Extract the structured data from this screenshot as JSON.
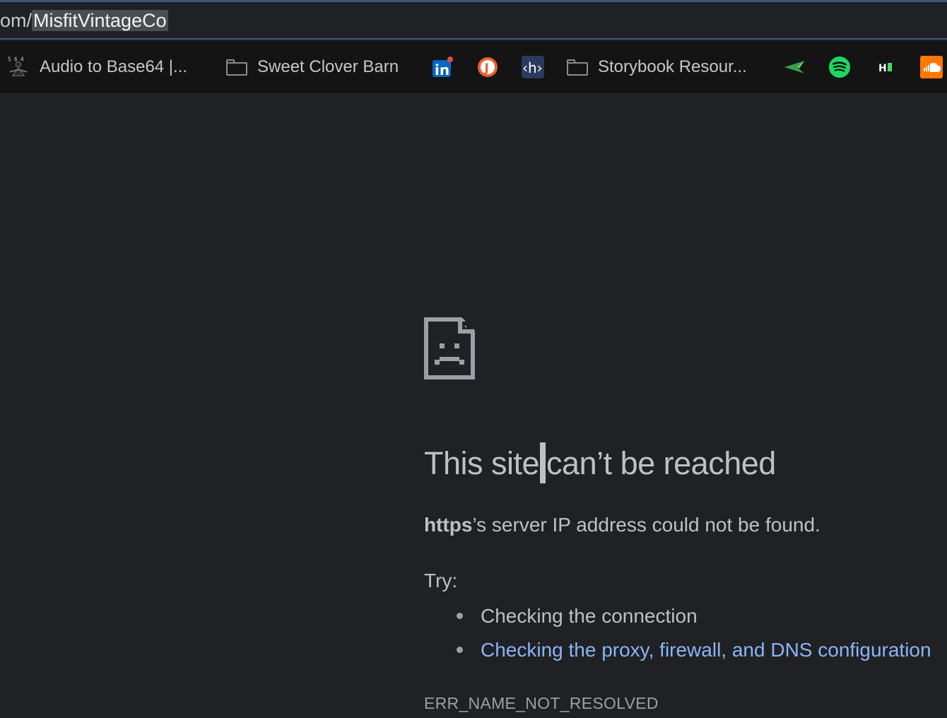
{
  "omnibox": {
    "url_prefix": "om/",
    "url_selected": "MisfitVintageCo"
  },
  "bookmarks": {
    "items": [
      {
        "label": "Audio to Base64 |...",
        "icon": "meditation-figure-icon"
      },
      {
        "label": "Sweet Clover Barn",
        "icon": "folder-icon"
      },
      {
        "label": "",
        "icon": "linkedin-icon"
      },
      {
        "label": "",
        "icon": "j-circle-icon"
      },
      {
        "label": "",
        "icon": "h-code-icon"
      },
      {
        "label": "Storybook Resour...",
        "icon": "folder-icon"
      },
      {
        "label": "",
        "icon": "paper-plane-icon"
      },
      {
        "label": "",
        "icon": "spotify-icon"
      },
      {
        "label": "",
        "icon": "hi-badge-icon"
      },
      {
        "label": "",
        "icon": "soundcloud-icon"
      }
    ]
  },
  "error_page": {
    "title_part1": "This site",
    "title_part2": "can’t be reached",
    "host": "https",
    "description": "’s server IP address could not be found.",
    "try_label": "Try:",
    "suggestions": [
      "Checking the connection",
      "Checking the proxy, firewall, and DNS configuration"
    ],
    "error_code": "ERR_NAME_NOT_RESOLVED"
  },
  "colors": {
    "background": "#202124",
    "text": "#bdc1c6",
    "link": "#8ab4f8",
    "omnibox_border": "#3d5f85"
  }
}
